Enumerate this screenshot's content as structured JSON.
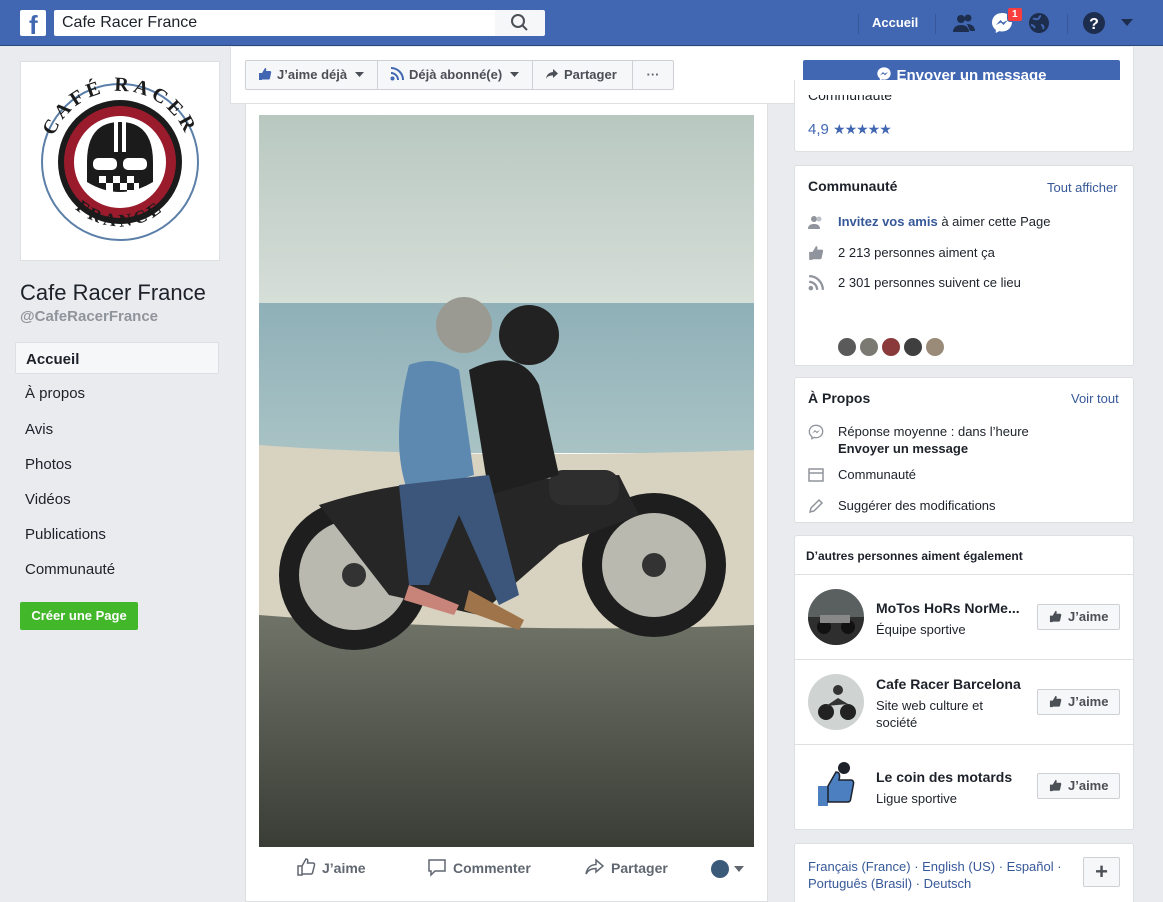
{
  "topbar": {
    "search_value": "Cafe Racer France",
    "home_label": "Accueil",
    "messages_badge": "1"
  },
  "page": {
    "logo_text_top": "CAFÉ RACER",
    "logo_text_bottom": "FRANCE",
    "name": "Cafe Racer France",
    "handle": "@CafeRacerFrance"
  },
  "left_nav": [
    {
      "label": "Accueil",
      "active": true
    },
    {
      "label": "À propos"
    },
    {
      "label": "Avis"
    },
    {
      "label": "Photos"
    },
    {
      "label": "Vidéos"
    },
    {
      "label": "Publications"
    },
    {
      "label": "Communauté"
    }
  ],
  "create_page_label": "Créer une Page",
  "actions": {
    "like": "J’aime déjà",
    "follow": "Déjà abonné(e)",
    "share": "Partager",
    "more": "···",
    "send_message": "Envoyer un message"
  },
  "post": {
    "like": "J’aime",
    "comment": "Commenter",
    "share": "Partager"
  },
  "rating": {
    "label": "Communauté",
    "value": "4,9",
    "stars": "★★★★★"
  },
  "community": {
    "title": "Communauté",
    "see_all": "Tout afficher",
    "invite_link": "Invitez vos amis",
    "invite_rest": " à aimer cette Page",
    "likes": "2 213 personnes aiment ça",
    "follows": "2 301 personnes suivent ce lieu"
  },
  "about": {
    "title": "À Propos",
    "see_all": "Voir tout",
    "response": "Réponse moyenne : dans l’heure",
    "send_message": "Envoyer un message",
    "category": "Communauté",
    "suggest": "Suggérer des modifications"
  },
  "suggestions": {
    "title": "D’autres personnes aiment également",
    "items": [
      {
        "name": "MoTos HoRs NorMe...",
        "category": "Équipe sportive",
        "button": "J’aime"
      },
      {
        "name": "Cafe Racer Barcelona",
        "category": "Site web culture et société",
        "button": "J’aime"
      },
      {
        "name": "Le coin des motards",
        "category": "Ligue sportive",
        "button": "J’aime"
      }
    ]
  },
  "languages": {
    "line1": "Français (France) · English (US) · Español ·",
    "line2": "Português (Brasil) · Deutsch",
    "plus": "+"
  },
  "colors": {
    "brand": "#4267b2",
    "link": "#365899",
    "green": "#42b72a",
    "badge": "#fa3e3e"
  }
}
